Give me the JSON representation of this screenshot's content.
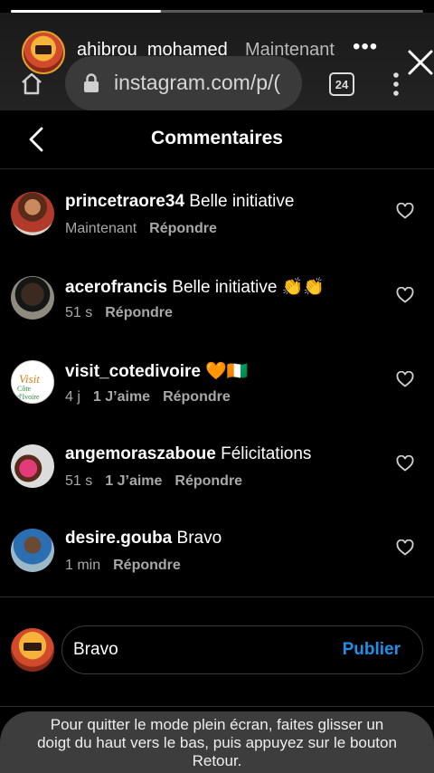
{
  "story": {
    "progress_fraction": 0.365,
    "username": "ahibrou_mohamed",
    "time": "Maintenant",
    "more": "•••",
    "url": "instagram.com/p/(",
    "tab_count": "24"
  },
  "header": {
    "title": "Commentaires"
  },
  "comments": [
    {
      "username": "princetraore34",
      "text": "Belle initiative",
      "time": "Maintenant",
      "likes": "",
      "reply": "Répondre"
    },
    {
      "username": "acerofrancis",
      "text": "Belle initiative 👏👏",
      "time": "51 s",
      "likes": "",
      "reply": "Répondre"
    },
    {
      "username": "visit_cotedivoire",
      "text": "🧡🇨🇮",
      "time": "4 j",
      "likes": "1 J’aime",
      "reply": "Répondre"
    },
    {
      "username": "angemoraszaboue",
      "text": "Félicitations",
      "time": "51 s",
      "likes": "1 J’aime",
      "reply": "Répondre"
    },
    {
      "username": "desire.gouba",
      "text": "Bravo",
      "time": "1 min",
      "likes": "",
      "reply": "Répondre"
    }
  ],
  "composer": {
    "value": "Bravo",
    "publish_label": "Publier"
  },
  "avatar3_logo": {
    "line1": "Visit",
    "line2": "Côte d'Ivoire"
  },
  "toast": {
    "line1": "Pour quitter le mode plein écran, faites glisser un",
    "line2": "doigt du haut vers le bas, puis appuyez sur le bouton",
    "line3": "Retour."
  },
  "colors": {
    "accent": "#1f8fe8",
    "background": "#000000",
    "secondary_text": "#a8a8a8"
  }
}
